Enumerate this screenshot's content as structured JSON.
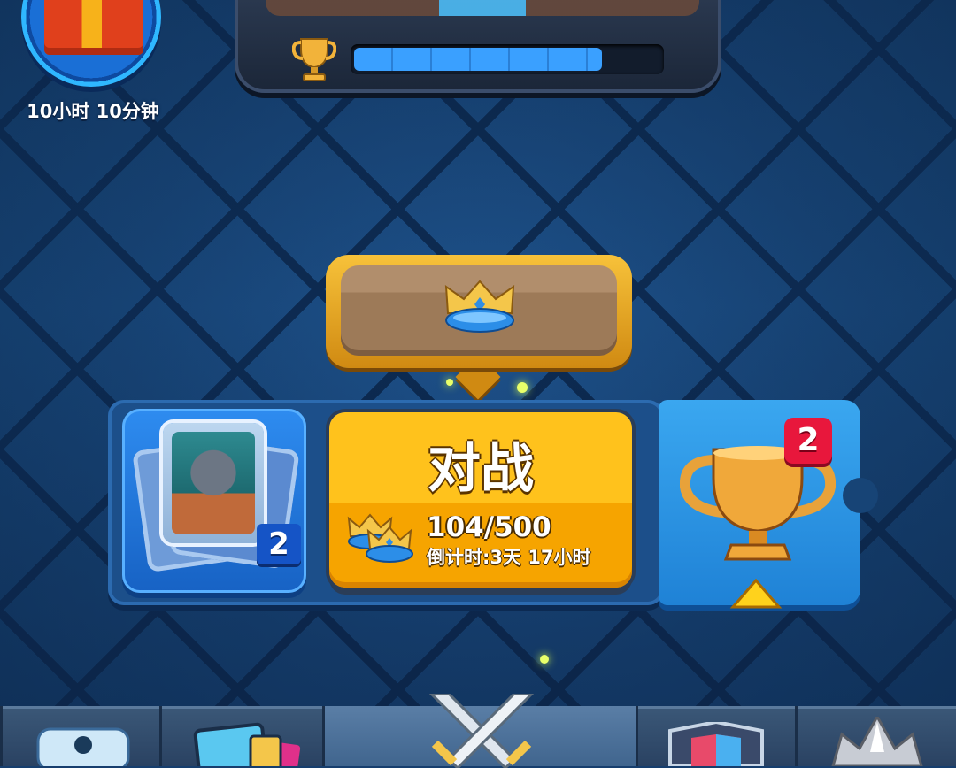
{
  "gift": {
    "timer": "10小时 10分钟"
  },
  "arena": {
    "trophy_progress": 0.81
  },
  "crown_chest": {
    "label": ""
  },
  "deck": {
    "badge": "2"
  },
  "battle": {
    "label": "对战",
    "crowns": "104/500",
    "countdown": "倒计时:3天 17小时"
  },
  "trophy_road": {
    "badge": "2"
  },
  "bottom_nav": {
    "tabs": [
      "shop-tab",
      "cards-tab",
      "battle-tab",
      "clan-tab",
      "events-tab"
    ],
    "active_index": 2
  },
  "colors": {
    "battle_button": "#ffc21c",
    "trophy_badge": "#e8173c",
    "deck_badge": "#1554c6",
    "background": "#163e6e"
  }
}
